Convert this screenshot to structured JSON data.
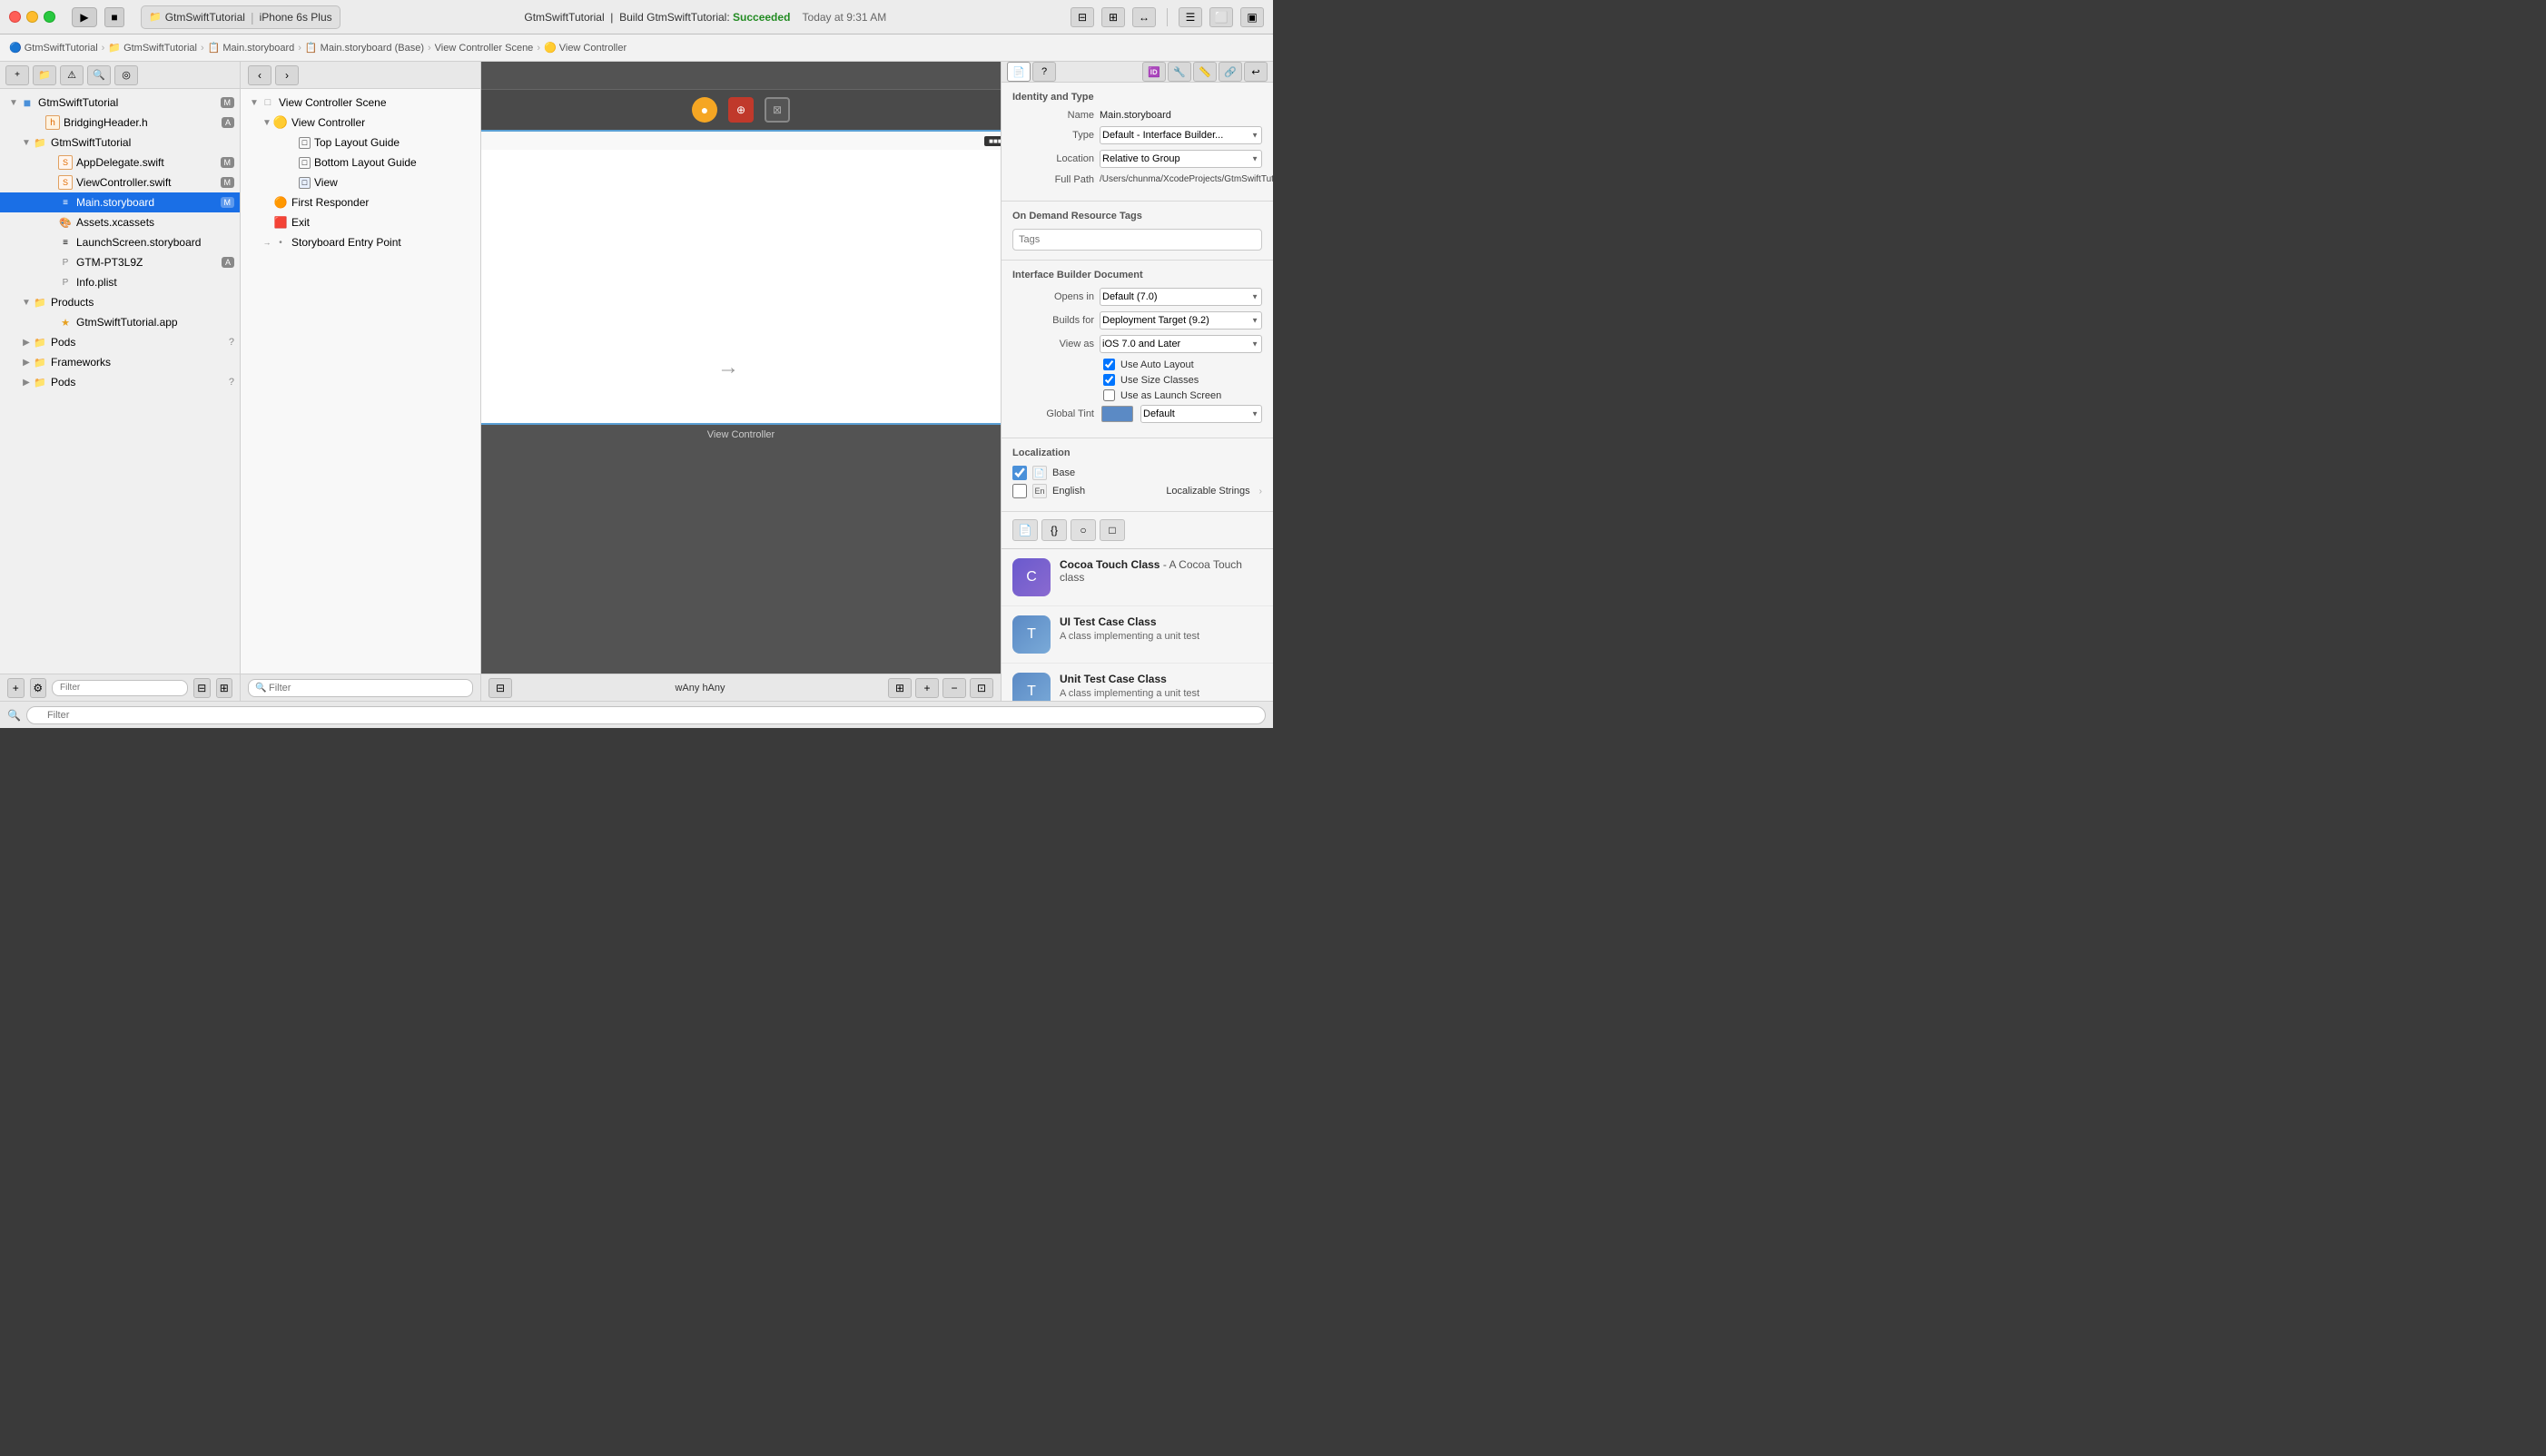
{
  "titlebar": {
    "project_name": "GtmSwiftTutorial",
    "device": "iPhone 6s Plus",
    "app_name": "GtmSwiftTutorial",
    "build_label": "Build GtmSwiftTutorial:",
    "build_status": "Succeeded",
    "build_time": "Today at 9:31 AM"
  },
  "breadcrumb": {
    "items": [
      "GtmSwiftTutorial",
      "GtmSwiftTutorial",
      "Main.storyboard",
      "Main.storyboard (Base)",
      "View Controller Scene",
      "View Controller"
    ]
  },
  "sidebar": {
    "items": [
      {
        "label": "GtmSwiftTutorial",
        "level": 0,
        "type": "project",
        "badge": "M",
        "expanded": true
      },
      {
        "label": "BridgingHeader.h",
        "level": 1,
        "type": "header",
        "badge": "A"
      },
      {
        "label": "GtmSwiftTutorial",
        "level": 1,
        "type": "group",
        "badge": "",
        "expanded": true
      },
      {
        "label": "AppDelegate.swift",
        "level": 2,
        "type": "swift",
        "badge": "M"
      },
      {
        "label": "ViewController.swift",
        "level": 2,
        "type": "swift",
        "badge": "M"
      },
      {
        "label": "Main.storyboard",
        "level": 2,
        "type": "storyboard",
        "badge": "M",
        "selected": true
      },
      {
        "label": "Assets.xcassets",
        "level": 2,
        "type": "assets"
      },
      {
        "label": "LaunchScreen.storyboard",
        "level": 2,
        "type": "storyboard"
      },
      {
        "label": "GTM-PT3L9Z",
        "level": 2,
        "type": "plist",
        "badge": "A"
      },
      {
        "label": "Info.plist",
        "level": 2,
        "type": "plist"
      },
      {
        "label": "Products",
        "level": 1,
        "type": "group",
        "expanded": true
      },
      {
        "label": "GtmSwiftTutorial.app",
        "level": 2,
        "type": "app"
      },
      {
        "label": "Pods",
        "level": 1,
        "type": "group",
        "badge": "?",
        "expanded": false
      },
      {
        "label": "Frameworks",
        "level": 1,
        "type": "group",
        "expanded": false
      },
      {
        "label": "Pods",
        "level": 1,
        "type": "group",
        "badge": "?",
        "expanded": false
      }
    ]
  },
  "outline": {
    "scene_label": "View Controller Scene",
    "vc_label": "View Controller",
    "items": [
      {
        "label": "View Controller Scene",
        "level": 0,
        "expanded": true
      },
      {
        "label": "View Controller",
        "level": 1,
        "expanded": true
      },
      {
        "label": "Top Layout Guide",
        "level": 2
      },
      {
        "label": "Bottom Layout Guide",
        "level": 2
      },
      {
        "label": "View",
        "level": 2
      },
      {
        "label": "First Responder",
        "level": 1
      },
      {
        "label": "Exit",
        "level": 1
      },
      {
        "label": "Storyboard Entry Point",
        "level": 1
      }
    ]
  },
  "storyboard": {
    "vc_title": "View Controller",
    "arrow_char": "→"
  },
  "inspector": {
    "title": "Identity and Type",
    "name_label": "Name",
    "name_value": "Main.storyboard",
    "type_label": "Type",
    "type_value": "Default - Interface Builder...",
    "location_label": "Location",
    "location_value": "Relative to Group",
    "full_path_label": "Full Path",
    "full_path_value": "/Users/chunma/XcodeProjects/GtmSwiftTutorial/GtmSwiftTutorial/Base.lproj/Main.storyboard",
    "on_demand_title": "On Demand Resource Tags",
    "tags_placeholder": "Tags",
    "ib_doc_title": "Interface Builder Document",
    "opens_in_label": "Opens in",
    "opens_in_value": "Default (7.0)",
    "builds_for_label": "Builds for",
    "builds_for_value": "Deployment Target (9.2)",
    "view_as_label": "View as",
    "view_as_value": "iOS 7.0 and Later",
    "use_auto_layout_label": "Use Auto Layout",
    "use_size_classes_label": "Use Size Classes",
    "use_as_launch_label": "Use as Launch Screen",
    "global_tint_label": "Global Tint",
    "global_tint_value": "Default",
    "localization_title": "Localization",
    "base_label": "Base",
    "english_label": "English",
    "localizable_strings": "Localizable Strings",
    "templates": [
      {
        "name": "Cocoa Touch Class",
        "desc": "A Cocoa Touch class",
        "type": "cocoa"
      },
      {
        "name": "UI Test Case Class",
        "desc": "A class implementing a unit test",
        "type": "ui"
      },
      {
        "name": "Unit Test Case Class",
        "desc": "A class implementing a unit test",
        "type": "unit"
      }
    ]
  },
  "bottom": {
    "filter_placeholder": "Filter",
    "size_label": "wAny hAny"
  },
  "icons": {
    "play": "▶",
    "stop": "■",
    "search": "🔍",
    "gear": "⚙",
    "folder": "📁",
    "file": "📄",
    "swift_s": "S",
    "storyboard_s": "≡",
    "arrow_right": "▶",
    "arrow_down": "▼",
    "plus": "+",
    "minus": "−",
    "back": "‹",
    "forward": "›"
  }
}
